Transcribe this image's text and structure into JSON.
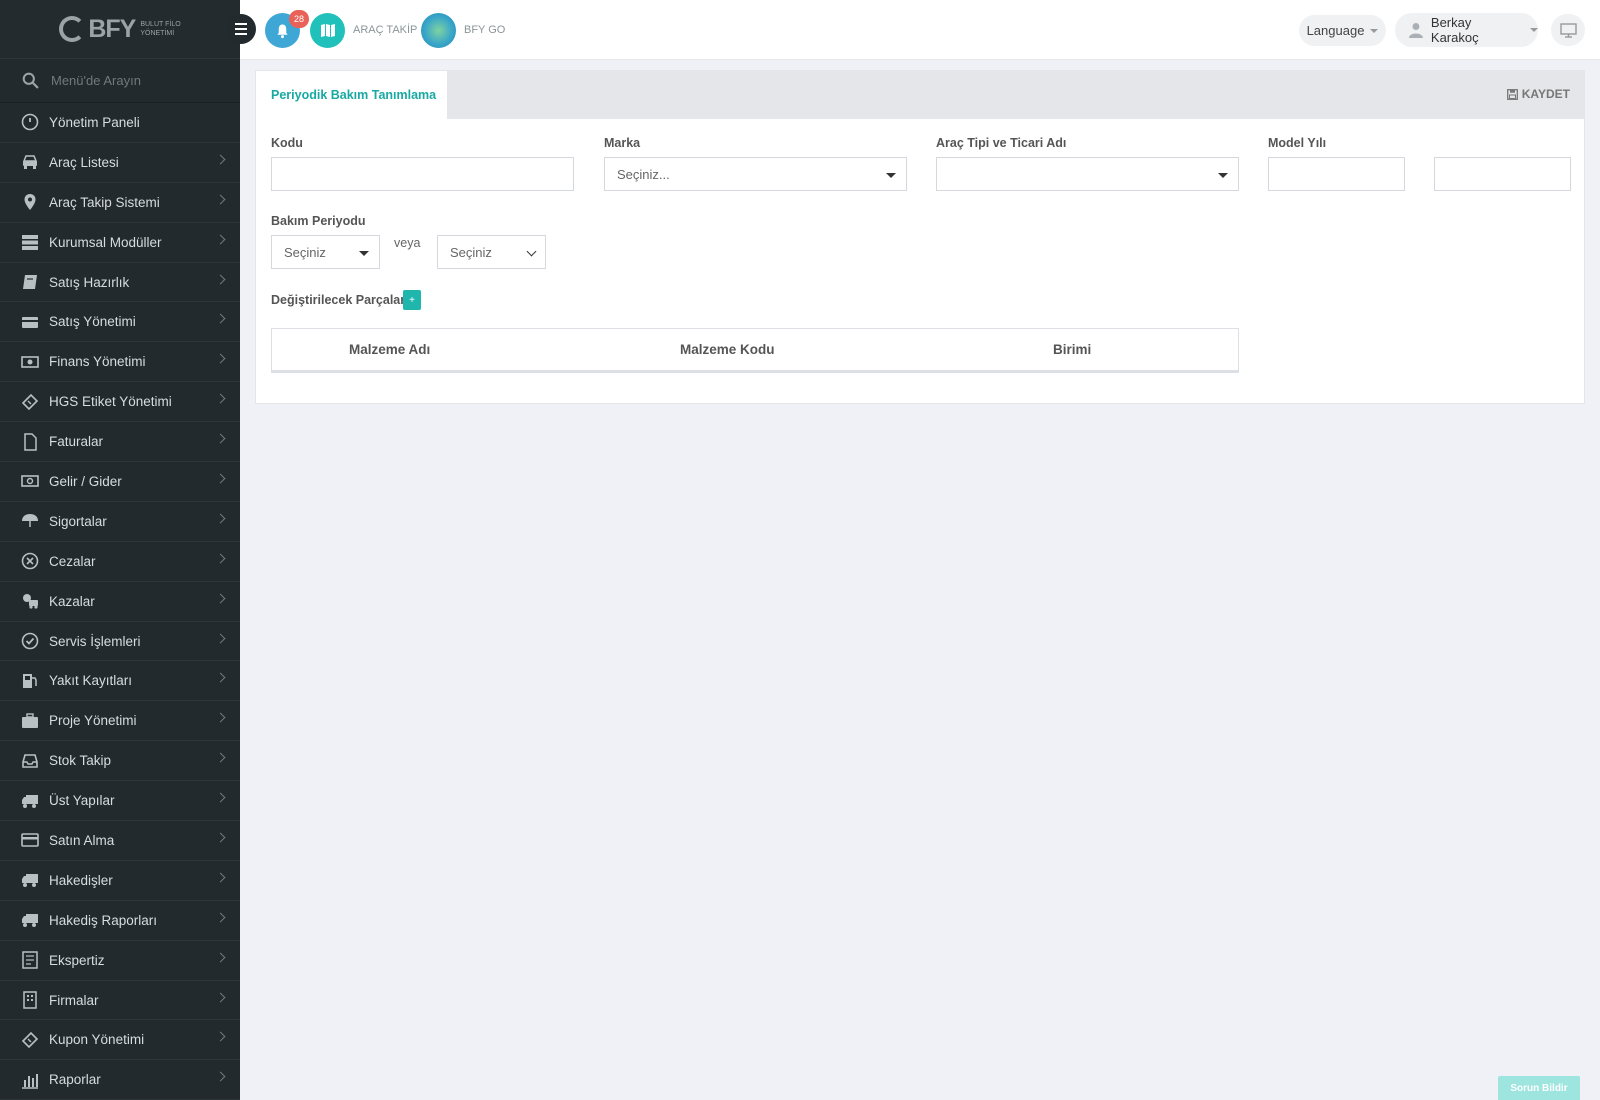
{
  "sidebar": {
    "logo_text": "BFY",
    "logo_sub_1": "BULUT FİLO",
    "logo_sub_2": "YÖNETİMİ",
    "search_placeholder": "Menü'de Arayın",
    "items": [
      {
        "label": "Yönetim Paneli",
        "icon": "dashboard-icon"
      },
      {
        "label": "Araç Listesi",
        "icon": "car-icon"
      },
      {
        "label": "Araç Takip Sistemi",
        "icon": "map-pin-icon"
      },
      {
        "label": "Kurumsal Modüller",
        "icon": "server-icon"
      },
      {
        "label": "Satış Hazırlık",
        "icon": "book-icon"
      },
      {
        "label": "Satış Yönetimi",
        "icon": "card-icon"
      },
      {
        "label": "Finans Yönetimi",
        "icon": "money-icon"
      },
      {
        "label": "HGS Etiket Yönetimi",
        "icon": "ticket-icon"
      },
      {
        "label": "Faturalar",
        "icon": "file-icon"
      },
      {
        "label": "Gelir / Gider",
        "icon": "cash-icon"
      },
      {
        "label": "Sigortalar",
        "icon": "umbrella-icon"
      },
      {
        "label": "Cezalar",
        "icon": "close-circle-icon"
      },
      {
        "label": "Kazalar",
        "icon": "crash-icon"
      },
      {
        "label": "Servis İşlemleri",
        "icon": "check-circle-icon"
      },
      {
        "label": "Yakıt Kayıtları",
        "icon": "fuel-icon"
      },
      {
        "label": "Proje Yönetimi",
        "icon": "briefcase-icon"
      },
      {
        "label": "Stok Takip",
        "icon": "inbox-icon"
      },
      {
        "label": "Üst Yapılar",
        "icon": "truck-icon"
      },
      {
        "label": "Satın Alma",
        "icon": "credit-card-icon"
      },
      {
        "label": "Hakedişler",
        "icon": "truck-icon"
      },
      {
        "label": "Hakediş Raporları",
        "icon": "truck-icon"
      },
      {
        "label": "Ekspertiz",
        "icon": "report-icon"
      },
      {
        "label": "Firmalar",
        "icon": "building-icon"
      },
      {
        "label": "Kupon Yönetimi",
        "icon": "ticket-icon"
      },
      {
        "label": "Raporlar",
        "icon": "bar-chart-icon"
      }
    ]
  },
  "topbar": {
    "notification_count": "28",
    "map_label": "ARAÇ TAKİP",
    "bfygo_label": "BFY GO",
    "language_label": "Language",
    "user_name": "Berkay Karakoç"
  },
  "card": {
    "tab_title": "Periyodik Bakım Tanımlama",
    "save_label": "KAYDET",
    "fields": {
      "kodu_label": "Kodu",
      "kodu_value": "",
      "marka_label": "Marka",
      "marka_value": "Seçiniz...",
      "arac_tipi_label": "Araç Tipi ve Ticari Adı",
      "arac_tipi_value": "",
      "model_yili_label": "Model Yılı",
      "model_yili_from": "",
      "model_yili_to": "",
      "bakim_periyodu_label": "Bakım Periyodu",
      "bakim_periyodu_value_1": "Seçiniz",
      "veya": "veya",
      "bakim_periyodu_value_2": "Seçiniz",
      "parts_label": "Değiştirilecek Parçalar",
      "add_part": "+"
    },
    "parts_table": {
      "columns": [
        "Malzeme Adı",
        "Malzeme Kodu",
        "Birimi"
      ],
      "rows": []
    }
  },
  "report_button": "Sorun Bildir",
  "colors": {
    "accent": "#17aaa3",
    "sidebar_bg": "#222a2d",
    "badge": "#e8625a"
  }
}
